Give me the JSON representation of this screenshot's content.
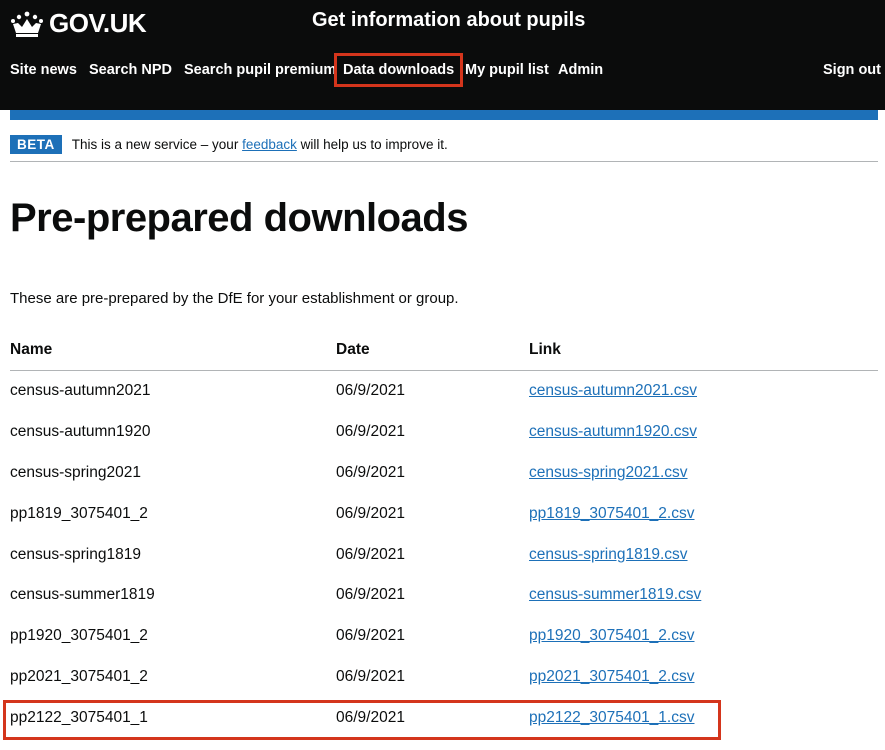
{
  "header": {
    "logo_text": "GOV.UK",
    "logo_icon": "crown-icon",
    "service_name": "Get information about pupils"
  },
  "nav": {
    "items": [
      {
        "label": "Site news"
      },
      {
        "label": "Search NPD"
      },
      {
        "label": "Search pupil premium"
      },
      {
        "label": "Data downloads"
      },
      {
        "label": "My pupil list"
      },
      {
        "label": "Admin"
      }
    ],
    "sign_out": "Sign out"
  },
  "phase_banner": {
    "tag": "BETA",
    "text_before": "This is a new service – your",
    "link": "feedback",
    "text_after": "will help us to improve it."
  },
  "main": {
    "title": "Pre-prepared downloads",
    "intro": "These are pre-prepared by the DfE for your establishment or group.",
    "table": {
      "headers": [
        "Name",
        "Date",
        "Link"
      ],
      "rows": [
        {
          "name": "census-autumn2021",
          "date": "06/9/2021",
          "link": "census-autumn2021.csv"
        },
        {
          "name": "census-autumn1920",
          "date": "06/9/2021",
          "link": "census-autumn1920.csv"
        },
        {
          "name": "census-spring2021",
          "date": "06/9/2021",
          "link": "census-spring2021.csv"
        },
        {
          "name": "pp1819_3075401_2",
          "date": "06/9/2021",
          "link": "pp1819_3075401_2.csv"
        },
        {
          "name": "census-spring1819",
          "date": "06/9/2021",
          "link": "census-spring1819.csv"
        },
        {
          "name": "census-summer1819",
          "date": "06/9/2021",
          "link": "census-summer1819.csv"
        },
        {
          "name": "pp1920_3075401_2",
          "date": "06/9/2021",
          "link": "pp1920_3075401_2.csv"
        },
        {
          "name": "pp2021_3075401_2",
          "date": "06/9/2021",
          "link": "pp2021_3075401_2.csv"
        },
        {
          "name": "pp2122_3075401_1",
          "date": "06/9/2021",
          "link": "pp2122_3075401_1.csv"
        }
      ]
    }
  },
  "colors": {
    "header_bg": "#0b0c0c",
    "brand_blue": "#1d70b8",
    "highlight_red": "#d4351c",
    "border_grey": "#b1b4b6"
  }
}
